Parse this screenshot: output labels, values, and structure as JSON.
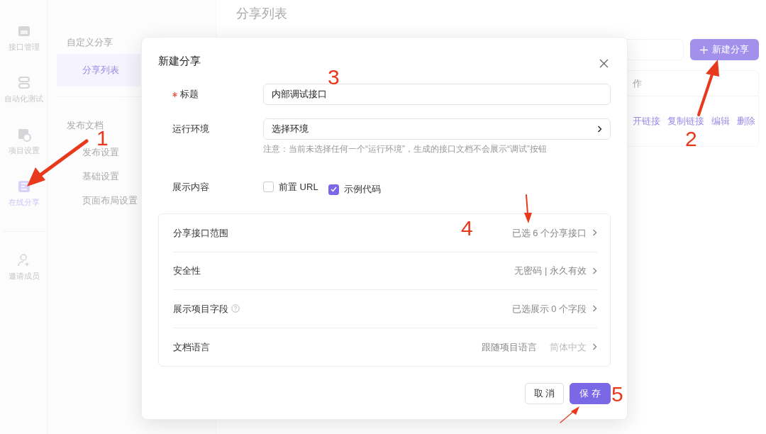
{
  "sidebar": {
    "items": [
      {
        "label": "接口管理",
        "kind": "api",
        "selected": false
      },
      {
        "label": "自动化测试",
        "kind": "test",
        "selected": false
      },
      {
        "label": "项目设置",
        "kind": "settings",
        "selected": false
      },
      {
        "label": "在线分享",
        "kind": "share",
        "selected": true
      },
      {
        "label": "邀请成员",
        "kind": "invite",
        "selected": false
      }
    ]
  },
  "submenu": {
    "groups": [
      {
        "title": "自定义分享",
        "items": [
          {
            "label": "分享列表",
            "selected": true
          }
        ]
      },
      {
        "title": "发布文档",
        "items": [
          {
            "label": "发布设置",
            "selected": false
          },
          {
            "label": "基础设置",
            "selected": false
          },
          {
            "label": "页面布局设置",
            "selected": false
          }
        ]
      }
    ]
  },
  "page": {
    "title": "分享列表",
    "new_button": "新建分享",
    "table": {
      "header": "作",
      "row_actions": [
        "开链接",
        "复制链接",
        "编辑",
        "删除"
      ]
    }
  },
  "dialog": {
    "title": "新建分享",
    "fields": [
      {
        "kind": "input",
        "label": "标题",
        "required": true,
        "value": "内部调试接口"
      },
      {
        "kind": "select",
        "label": "运行环境",
        "required": false,
        "value": "选择环境",
        "note": "注意：当前未选择任何一个“运行环境”，生成的接口文档不会展示“调试”按钮"
      },
      {
        "kind": "checks",
        "label": "展示内容",
        "required": false,
        "options": [
          {
            "label": "前置 URL",
            "checked": false
          },
          {
            "label": "示例代码",
            "checked": true
          }
        ]
      }
    ],
    "settings": [
      {
        "label": "分享接口范围",
        "help": false,
        "value": "已选 6 个分享接口"
      },
      {
        "label": "安全性",
        "help": false,
        "value": "无密码 | 永久有效"
      },
      {
        "label": "展示项目字段",
        "help": true,
        "value": "已选展示 0 个字段"
      },
      {
        "label": "文档语言",
        "help": false,
        "value": "跟随项目语言",
        "secondary": "简体中文"
      }
    ],
    "buttons": [
      {
        "label": "取 消",
        "kind": "default"
      },
      {
        "label": "保 存",
        "kind": "primary"
      }
    ]
  },
  "annotations": [
    {
      "label": "1"
    },
    {
      "label": "2"
    },
    {
      "label": "3"
    },
    {
      "label": "4"
    },
    {
      "label": "5"
    }
  ]
}
